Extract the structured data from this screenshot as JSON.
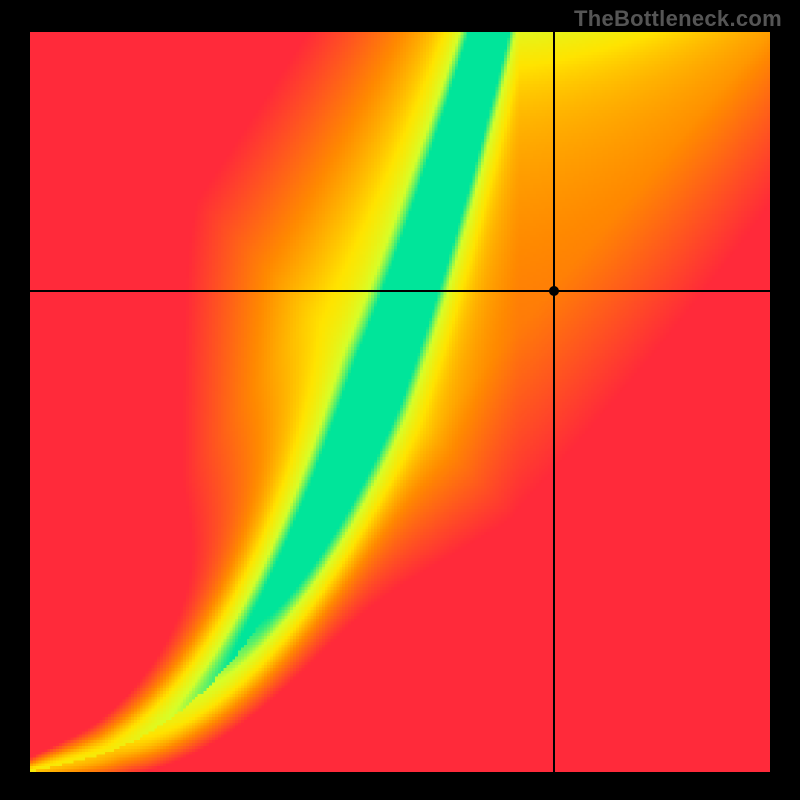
{
  "watermark": "TheBottleneck.com",
  "chart_data": {
    "type": "heatmap",
    "title": "",
    "xlabel": "",
    "ylabel": "",
    "xlim": [
      0,
      1
    ],
    "ylim": [
      0,
      1
    ],
    "color_scale": {
      "low": "#ff2a3a",
      "mid_low": "#ff8a00",
      "mid": "#ffe400",
      "mid_high": "#d6ff2a",
      "high": "#00e59a"
    },
    "ridge_description": "Green optimal band follows a monotonically increasing curve from origin to upper-right, steeper below x≈0.4 (near 45°), then bending leftward into a narrower, more vertical band above.",
    "marker": {
      "x": 0.708,
      "y": 0.65
    },
    "crosshair": {
      "x": 0.708,
      "y": 0.65
    },
    "grid": false,
    "legend": null
  },
  "plot": {
    "inner_size_px": 740,
    "heatmap_resolution": 256
  },
  "colors": {
    "background": "#000000",
    "watermark": "#555555",
    "crosshair": "#000000",
    "marker": "#000000"
  }
}
